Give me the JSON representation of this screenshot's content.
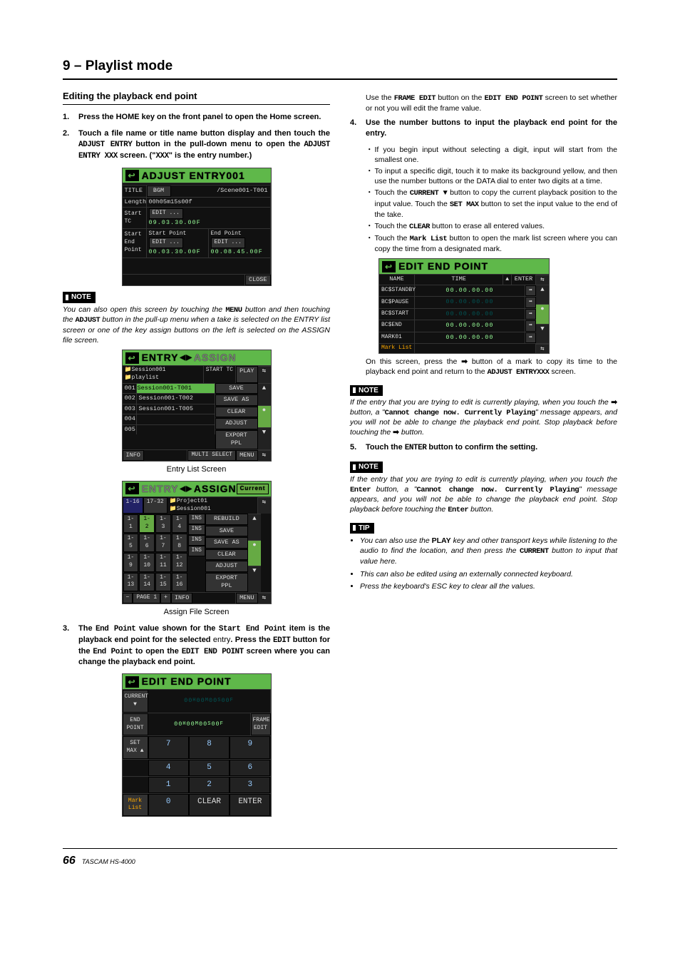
{
  "chapter": "9 – Playlist mode",
  "left": {
    "section_title": "Editing the playback end point",
    "step1": {
      "num": "1.",
      "text": "Press the HOME key on the front panel to open the Home screen."
    },
    "step2": {
      "num": "2.",
      "text_a": "Touch a file name or title name button display and then touch the ",
      "mono_a": "ADJUST ENTRY",
      "text_b": " button in the pull-down menu to open the ",
      "mono_b": "ADJUST ENTRY XXX",
      "text_c": " screen. (\"",
      "mono_c": "XXX",
      "text_d": "\" is the entry number.)"
    },
    "note_label": "NOTE",
    "note_text_a": "You can also open this screen by touching the ",
    "note_mono_a": "MENU",
    "note_text_b": " button and then touching the ",
    "note_mono_b": "ADJUST",
    "note_text_c": " button in the pull-up menu when a take is selected on the ENTRY list screen or one of the key assign buttons on the left is selected on the ASSIGN file screen.",
    "caption1": "Entry List Screen",
    "caption2": "Assign File Screen",
    "step3": {
      "num": "3.",
      "text_a": "The ",
      "mono_a": "End Point",
      "text_b": " value shown for the ",
      "mono_b": "Start End Point",
      "text_c": " item is the playback end point for the selected ",
      "light_entry": "entry",
      "text_d": ". Press the ",
      "mono_c": "EDIT",
      "text_e": " button for the ",
      "mono_d": "End Point",
      "text_f": " to open the ",
      "mono_e": "EDIT END POINT",
      "text_g": " screen where you can change the playback end point."
    }
  },
  "right": {
    "para1_a": "Use the ",
    "para1_mono_a": "FRAME EDIT",
    "para1_b": " button on the ",
    "para1_mono_b": "EDIT END POINT",
    "para1_c": " screen to set whether or not you will edit the frame value.",
    "step4": {
      "num": "4.",
      "text": "Use the number buttons to input the playback end point for the entry."
    },
    "bullets": [
      "If you begin input without selecting a digit, input will start from the smallest one.",
      "To input a specific digit, touch it to make its background yellow, and then use the number buttons or the DATA dial to enter two digits at a time."
    ],
    "bullet3_a": "Touch the ",
    "bullet3_mono_a": "CURRENT ▼",
    "bullet3_b": " button to copy the current playback position to the input value. Touch the ",
    "bullet3_mono_b": "SET MAX",
    "bullet3_c": " button to set the input value to the end of the take.",
    "bullet4_a": "Touch the ",
    "bullet4_mono": "CLEAR",
    "bullet4_b": " button to erase all entered values.",
    "bullet5_a": "Touch the ",
    "bullet5_mono": "Mark List",
    "bullet5_b": " button to open the mark list screen where you can copy the time from a designated mark.",
    "after_marks_a": "On this screen, press the ",
    "after_marks_arrow": "➡",
    "after_marks_b": " button of a mark to copy its time to the playback end point and return to the ",
    "after_marks_mono": "ADJUST ENTRYXXX",
    "after_marks_c": " screen.",
    "note2_label": "NOTE",
    "note2_a": "If the entry that you are trying to edit is currently playing, when you touch the ",
    "note2_arrow": "➡",
    "note2_b": " button, a \"",
    "note2_mono": "Cannot change now. Currently Playing",
    "note2_c": "\" message appears, and you will not be able to change the playback end point. Stop playback before touching the ",
    "note2_arrow2": "➡",
    "note2_d": " button.",
    "step5": {
      "num": "5.",
      "text_a": "Touch the ",
      "mono": "ENTER",
      "text_b": " button to confirm the setting."
    },
    "note3_label": "NOTE",
    "note3_a": "If the entry that you are trying to edit is currently playing, when you touch the ",
    "note3_mono_a": "Enter",
    "note3_b": " button, a \"",
    "note3_mono_b": "Cannot change now. Currently Playing",
    "note3_c": "\" message appears, and you will not be able to change the playback end point. Stop playback before touching the ",
    "note3_mono_c": "Enter",
    "note3_d": " button.",
    "tip_label": "TIP",
    "tip1_a": "You can also use the ",
    "tip1_bold": "PLAY",
    "tip1_b": " key and other transport keys while listening to the audio to find the location, and then press the ",
    "tip1_mono": "CURRENT",
    "tip1_c": " button to input that value here.",
    "tip2": "This can also be edited using an externally connected keyboard.",
    "tip3": "Press the keyboard's ESC key to clear all the values."
  },
  "adjust_screen": {
    "title": "ADJUST ENTRY001",
    "title_label": "TITLE",
    "title_btn": "BGM",
    "path": "/Scene001-T001",
    "length_label": "Length",
    "length_val": "00h05m15s00f",
    "starttc_label": "Start\nTC",
    "edit_btn": "EDIT ...",
    "starttc_val": "09.03.30.00F",
    "sep_label": "Start\nEnd\nPoint",
    "sp_label": "Start Point",
    "sp_val": "00.03.30.00F",
    "ep_label": "End Point",
    "ep_val": "00.08.45.00F",
    "close": "CLOSE"
  },
  "entry_screen": {
    "title_l": "ENTRY",
    "mid_arrow": "◀▶",
    "title_r": "ASSIGN",
    "session": "Session001",
    "playlist": "playlist",
    "start_tc": "START TC",
    "play": "PLAY",
    "rows": [
      "001 Session001-T001",
      "002 Session001-T002",
      "003 Session001-T005",
      "004",
      "005"
    ],
    "info": "INFO",
    "buttons": [
      "SAVE",
      "SAVE AS",
      "CLEAR",
      "ADJUST",
      "EXPORT PPL"
    ],
    "multi": "MULTI SELECT",
    "menu": "MENU"
  },
  "assign_screen": {
    "title_l": "ENTRY",
    "mid_arrow": "◀▶",
    "title_r": "ASSIGN",
    "tabs": [
      "1-16",
      "17-32"
    ],
    "proj": "Project01",
    "sess": "Session001",
    "current": "Current",
    "keys": [
      "1-1",
      "1-2",
      "1-3",
      "1-4",
      "1-5",
      "1-6",
      "1-7",
      "1-8",
      "1-9",
      "1-10",
      "1-11",
      "1-12",
      "1-13",
      "1-14",
      "1-15",
      "1-16"
    ],
    "ins": "INS",
    "buttons": [
      "REBUILD",
      "SAVE",
      "SAVE AS",
      "CLEAR",
      "ADJUST",
      "EXPORT PPL"
    ],
    "page": "PAGE 1",
    "info": "INFO",
    "menu": "MENU"
  },
  "edit_screen": {
    "title": "EDIT END POINT",
    "current": "CURRENT ▼",
    "endpoint": "END POINT",
    "setmax": "SET MAX ▲",
    "frame": "FRAME EDIT",
    "digits": [
      "00",
      "00",
      "00",
      "00"
    ],
    "h": "H",
    "m": "M",
    "s": "S",
    "f": "F",
    "row1": [
      "7",
      "8",
      "9"
    ],
    "row2": [
      "4",
      "5",
      "6"
    ],
    "row3": [
      "1",
      "2",
      "3"
    ],
    "zero": "0",
    "clear": "CLEAR",
    "enter": "ENTER",
    "mark": "Mark List"
  },
  "marks_screen": {
    "title": "EDIT END POINT",
    "name": "NAME",
    "time": "TIME",
    "enter": "ENTER",
    "rows": [
      {
        "name": "BC$STANDBY",
        "time": "00.00.00.00",
        "lit": true
      },
      {
        "name": "BC$PAUSE",
        "time": "00.00.00.00",
        "lit": false
      },
      {
        "name": "BC$START",
        "time": "00.00.00.00",
        "lit": false
      },
      {
        "name": "BC$END",
        "time": "00.00.00.00",
        "lit": true
      },
      {
        "name": "MARK01",
        "time": "00.00.00.00",
        "lit": true
      }
    ],
    "mark_list": "Mark List"
  },
  "footer": {
    "page": "66",
    "brand": "TASCAM  HS-4000"
  }
}
